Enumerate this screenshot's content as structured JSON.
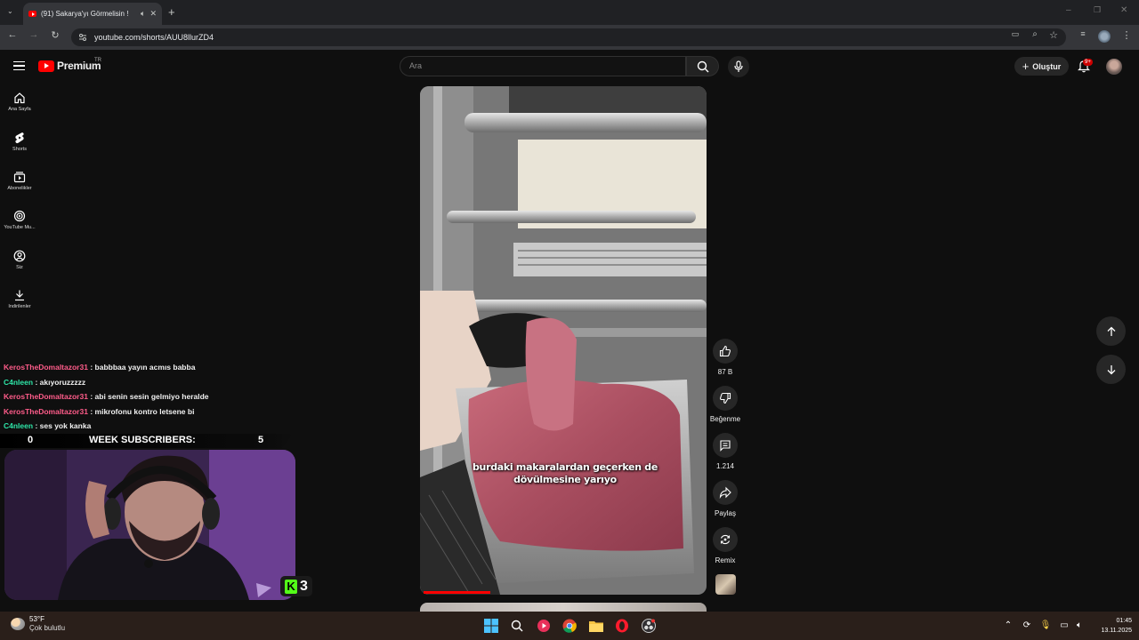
{
  "browser": {
    "tab_title": "(91) Sakarya'yı Görmelisin !",
    "url": "youtube.com/shorts/AUU8llurZD4",
    "icons": [
      "tab-list-icon",
      "speaker-icon",
      "close-icon",
      "new-tab-icon",
      "back-icon",
      "forward-icon",
      "reload-icon",
      "site-info-icon",
      "cast-icon",
      "zoom-icon",
      "bookmark-star-icon",
      "media-control-icon",
      "profile-icon",
      "menu-dots-icon",
      "minimize-icon",
      "maximize-icon",
      "window-close-icon"
    ]
  },
  "youtube": {
    "logo_text": "Premium",
    "country_code": "TR",
    "search_placeholder": "Ara",
    "create_label": "Oluştur",
    "notification_count": "9+",
    "sidebar": [
      {
        "label": "Ana Sayfa",
        "icon": "home-icon"
      },
      {
        "label": "Shorts",
        "icon": "shorts-icon"
      },
      {
        "label": "Abonelikler",
        "icon": "subscriptions-icon"
      },
      {
        "label": "YouTube Mu...",
        "icon": "music-icon"
      },
      {
        "label": "Siz",
        "icon": "account-icon"
      },
      {
        "label": "İndirilenler",
        "icon": "download-icon"
      }
    ],
    "video": {
      "caption": "burdaki makaralardan geçerken de dövülmesine yarıyo",
      "progress_fraction": 0.24
    },
    "actions": {
      "like_count": "87 B",
      "dislike_label": "Beğenme",
      "comment_count": "1.214",
      "share_label": "Paylaş",
      "remix_label": "Remix"
    }
  },
  "stream_overlay": {
    "chat": [
      {
        "user": "KerosTheDomaltazor31",
        "color": "#ff5c8a",
        "message": ": babbbaa yayın acmıs babba"
      },
      {
        "user": "C4nleen",
        "color": "#2ee6a8",
        "message": ": akıyoruzzzzz"
      },
      {
        "user": "KerosTheDomaltazor31",
        "color": "#ff5c8a",
        "message": ": abi senin sesin gelmiyo heralde"
      },
      {
        "user": "KerosTheDomaltazor31",
        "color": "#ff5c8a",
        "message": ": mikrofonu kontro letsene bi"
      },
      {
        "user": "C4nleen",
        "color": "#2ee6a8",
        "message": ": ses yok kanka"
      }
    ],
    "subs_bar": {
      "left_count": "0",
      "label": "WEEK SUBSCRIBERS:",
      "right_count": "5"
    },
    "kick_viewers": "3"
  },
  "taskbar": {
    "temperature": "53°F",
    "condition": "Çok bulutlu",
    "time": "01:45",
    "date": "13.11.2025"
  }
}
